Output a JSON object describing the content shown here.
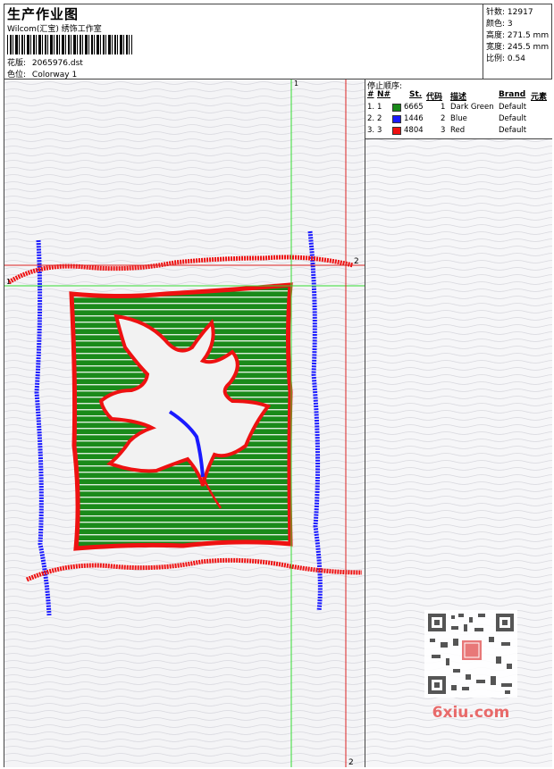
{
  "header": {
    "title": "生产作业图",
    "company": "Wilcom(汇宝) 绣饰工作室",
    "design_label": "花版:",
    "design_value": "2065976.dst",
    "colorway_label": "色位:",
    "colorway_value": "Colorway 1"
  },
  "stats": {
    "stitches_label": "针数:",
    "stitches_value": "12917",
    "colors_label": "颜色:",
    "colors_value": "3",
    "height_label": "高度:",
    "height_value": "271.5 mm",
    "width_label": "宽度:",
    "width_value": "245.5 mm",
    "scale_label": "比例:",
    "scale_value": "0.54"
  },
  "stop_sequence": {
    "title": "停止顺序:",
    "columns": [
      "#",
      "N#",
      "St.",
      "代码",
      "描述",
      "Brand",
      "元素"
    ],
    "rows": [
      {
        "index": "1.",
        "num": "1",
        "stitches": "6665",
        "code": "1",
        "desc": "Dark Green",
        "brand": "Default",
        "color": "#1a8a1a"
      },
      {
        "index": "2.",
        "num": "2",
        "stitches": "1446",
        "code": "2",
        "desc": "Blue",
        "brand": "Default",
        "color": "#1a1aff"
      },
      {
        "index": "3.",
        "num": "3",
        "stitches": "4804",
        "code": "3",
        "desc": "Red",
        "brand": "Default",
        "color": "#ee1111"
      }
    ]
  },
  "guides": {
    "vertical_top_label": "1",
    "horizontal_left_label": "1",
    "horizontal_right_label": "2",
    "vertical_bottom_label": "2"
  },
  "colors": {
    "green": "#1a8a1a",
    "red": "#ee1111",
    "blue": "#1a1aff",
    "guide_green": "#33dd33",
    "guide_red": "#dd2222"
  },
  "watermark": {
    "text": "6xiu.com"
  }
}
